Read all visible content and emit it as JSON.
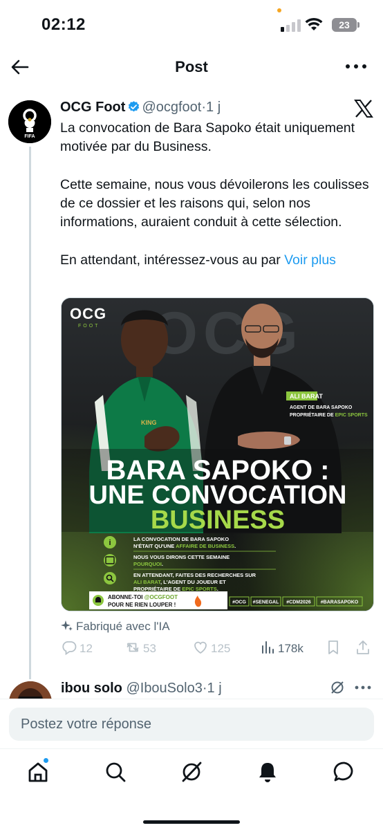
{
  "status_bar": {
    "time": "02:12",
    "battery": "23"
  },
  "header": {
    "title": "Post"
  },
  "post": {
    "author_name": "OCG Foot",
    "handle": "@ocgfoot",
    "separator": "·",
    "age": "1 j",
    "paragraphs": [
      "La convocation de Bara Sapoko était uniquement motivée par du Business.",
      "Cette semaine, nous vous dévoilerons les coulisses de ce dossier et les raisons qui, selon nos informations, auraient conduit à cette sélection."
    ],
    "truncated_line": "En attendant, intéressez-vous au par",
    "see_more": "Voir plus",
    "ai_label": "Fabriqué avec l'IA",
    "stats": {
      "replies": "12",
      "reposts": "53",
      "likes": "125",
      "views": "178k"
    }
  },
  "media": {
    "logo": "OCG",
    "logo_sub": "FOOT",
    "watermark": "OCG",
    "person_name": "ALI BARAT",
    "person_role_1": "AGENT DE BARA SAPOKO",
    "person_role_2_prefix": "PROPRIÉTAIRE DE ",
    "person_role_2_highlight": "EPIC SPORTS",
    "jersey_text": "KING",
    "headline_1": "BARA SAPOKO :",
    "headline_2": "UNE CONVOCATION",
    "headline_3": "BUSINESS",
    "bullets": [
      {
        "icon": "info-icon",
        "line1": "LA CONVOCATION DE BARA SAPOKO",
        "line2_prefix": "N'ÉTAIT QU'UNE ",
        "line2_highlight": "AFFAIRE DE BUSINESS",
        "line2_suffix": ".",
        "line3": ""
      },
      {
        "icon": "calendar-icon",
        "line1": "NOUS VOUS DIRONS CETTE SEMAINE",
        "line2_prefix": "",
        "line2_highlight": "POURQUOI",
        "line2_suffix": ".",
        "line3": ""
      },
      {
        "icon": "search-icon",
        "line1_prefix": "EN ATTENDANT, FAITES DES RECHERCHES SUR",
        "line1": "EN ATTENDANT, FAITES DES RECHERCHES SUR",
        "line2_prefix": "",
        "line2_highlight": "ALI BARAT",
        "line2_suffix": ", L'AGENT DU JOUEUR ET",
        "line3_prefix": "PROPRIÉTAIRE DE ",
        "line3_highlight": "EPIC SPORTS",
        "line3_suffix": "."
      }
    ],
    "subscribe_1_prefix": "ABONNE-TOI ",
    "subscribe_1_highlight": "@OCGFOOT",
    "subscribe_2": "POUR NE RIEN LOUPER !",
    "hashtags": [
      "#OCG",
      "#SENEGAL",
      "#CDM2026",
      "#BARASAPOKO"
    ],
    "colors": {
      "accent": "#8cc63f",
      "dark": "#111314"
    }
  },
  "reply": {
    "author_name": "ibou solo",
    "handle": "@IbouSolo3",
    "separator": "·",
    "age": "1 j"
  },
  "composer": {
    "placeholder": "Postez votre réponse"
  },
  "nav": {
    "items": [
      "home-icon",
      "search-icon",
      "grok-icon",
      "notifications-icon",
      "messages-icon"
    ]
  },
  "colors": {
    "link": "#1d9bf0",
    "muted": "#536471",
    "text": "#0f1419"
  }
}
